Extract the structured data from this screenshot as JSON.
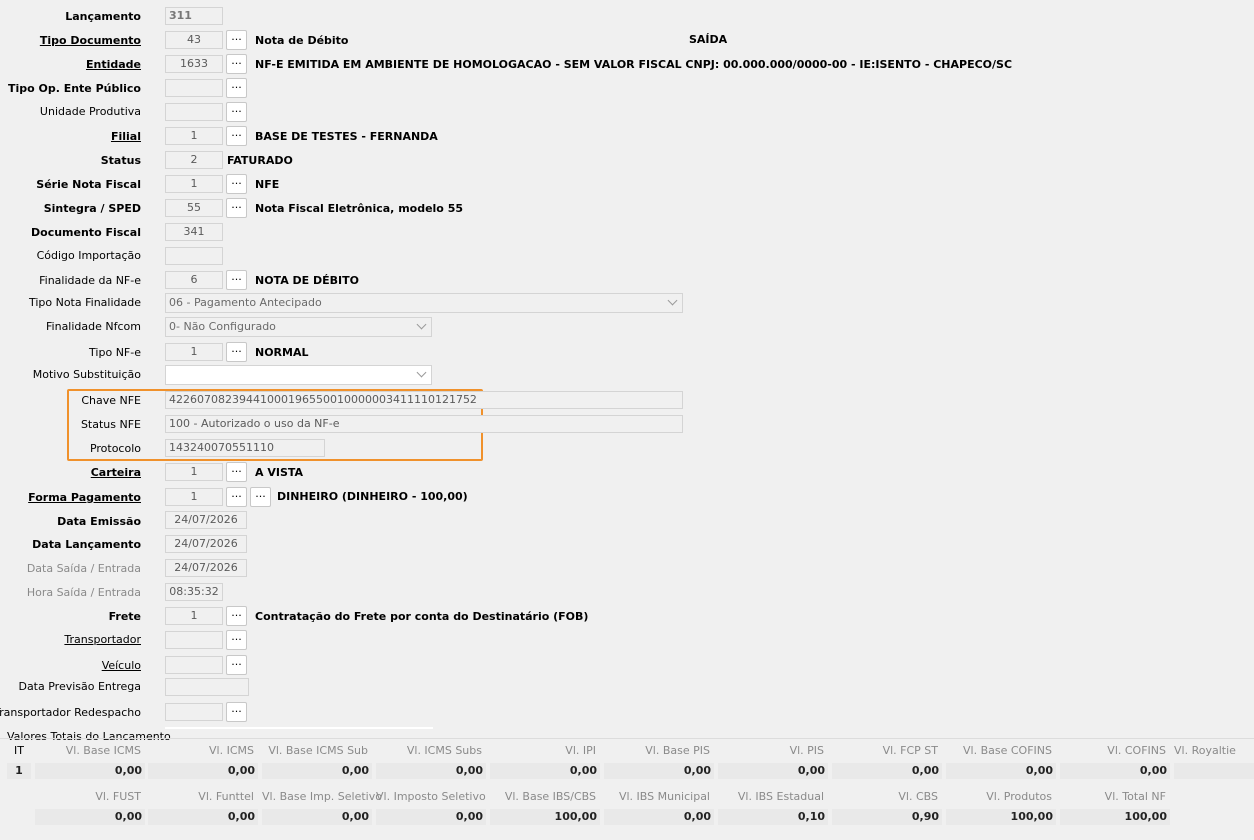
{
  "form": {
    "lancamento": {
      "label": "Lançamento",
      "value": "311"
    },
    "tipo_documento": {
      "label": "Tipo Documento",
      "code": "43",
      "desc": "Nota de Débito",
      "extra": "SAÍDA"
    },
    "entidade": {
      "label": "Entidade",
      "code": "1633",
      "desc": "NF-E EMITIDA EM AMBIENTE DE HOMOLOGACAO - SEM VALOR FISCAL CNPJ: 00.000.000/0000-00 - IE:ISENTO - CHAPECO/SC"
    },
    "tipo_op_ente": {
      "label": "Tipo Op. Ente Público",
      "code": ""
    },
    "unidade_produtiva": {
      "label": "Unidade Produtiva",
      "code": ""
    },
    "filial": {
      "label": "Filial",
      "code": "1",
      "desc": "BASE DE TESTES - FERNANDA"
    },
    "status": {
      "label": "Status",
      "code": "2",
      "desc": "FATURADO"
    },
    "serie": {
      "label": "Série Nota Fiscal",
      "code": "1",
      "desc": "NFE"
    },
    "sintegra": {
      "label": "Sintegra / SPED",
      "code": "55",
      "desc": "Nota Fiscal Eletrônica, modelo 55"
    },
    "documento_fiscal": {
      "label": "Documento Fiscal",
      "value": "341"
    },
    "codigo_importacao": {
      "label": "Código Importação",
      "value": ""
    },
    "finalidade_nfe": {
      "label": "Finalidade da NF-e",
      "code": "6",
      "desc": "NOTA DE DÉBITO"
    },
    "tipo_nota_finalidade": {
      "label": "Tipo Nota Finalidade",
      "value": "06 - Pagamento Antecipado"
    },
    "finalidade_nfcom": {
      "label": "Finalidade Nfcom",
      "value": "0- Não Configurado"
    },
    "tipo_nfe": {
      "label": "Tipo NF-e",
      "code": "1",
      "desc": "NORMAL"
    },
    "motivo_substituicao": {
      "label": "Motivo Substituição",
      "value": ""
    },
    "chave_nfe": {
      "label": "Chave NFE",
      "value": "42260708239441000196550010000003411110121752"
    },
    "status_nfe": {
      "label": "Status NFE",
      "value": "100 - Autorizado o uso da NF-e"
    },
    "protocolo": {
      "label": "Protocolo",
      "value": "143240070551110"
    },
    "carteira": {
      "label": "Carteira",
      "code": "1",
      "desc": "A VISTA"
    },
    "forma_pagamento": {
      "label": "Forma Pagamento",
      "code": "1",
      "desc": "DINHEIRO (DINHEIRO - 100,00)"
    },
    "data_emissao": {
      "label": "Data Emissão",
      "value": "24/07/2026"
    },
    "data_lancamento": {
      "label": "Data Lançamento",
      "value": "24/07/2026"
    },
    "data_saida": {
      "label": "Data Saída / Entrada",
      "value": "24/07/2026"
    },
    "hora_saida": {
      "label": "Hora Saída / Entrada",
      "value": "08:35:32"
    },
    "frete": {
      "label": "Frete",
      "code": "1",
      "desc": "Contratação do Frete por conta do Destinatário (FOB)"
    },
    "transportador": {
      "label": "Transportador",
      "code": ""
    },
    "veiculo": {
      "label": "Veículo",
      "code": ""
    },
    "data_previsao": {
      "label": "Data Previsão Entrega",
      "value": ""
    },
    "transportador_redespacho": {
      "label": "Transportador Redespacho",
      "code": ""
    },
    "button_label": "..."
  },
  "totals": {
    "section_title": "Valores Totais do Lancamento",
    "it_header": "IT",
    "it_value": "1",
    "row1": [
      {
        "h": "Vl. Base ICMS",
        "v": "0,00"
      },
      {
        "h": "Vl. ICMS",
        "v": "0,00"
      },
      {
        "h": "Vl. Base ICMS Sub",
        "v": "0,00"
      },
      {
        "h": "Vl. ICMS Subs",
        "v": "0,00"
      },
      {
        "h": "Vl. IPI",
        "v": "0,00"
      },
      {
        "h": "Vl. Base PIS",
        "v": "0,00"
      },
      {
        "h": "Vl. PIS",
        "v": "0,00"
      },
      {
        "h": "Vl. FCP ST",
        "v": "0,00"
      },
      {
        "h": "Vl. Base COFINS",
        "v": "0,00"
      },
      {
        "h": "Vl. COFINS",
        "v": "0,00"
      },
      {
        "h": "Vl. Royaltie",
        "v": ""
      }
    ],
    "row2": [
      {
        "h": "Vl. FUST",
        "v": "0,00"
      },
      {
        "h": "Vl. Funttel",
        "v": "0,00"
      },
      {
        "h": "Vl. Base Imp. Seletivo",
        "v": "0,00"
      },
      {
        "h": "Vl. Imposto Seletivo",
        "v": "0,00"
      },
      {
        "h": "Vl. Base IBS/CBS",
        "v": "100,00"
      },
      {
        "h": "Vl. IBS Municipal",
        "v": "0,00"
      },
      {
        "h": "Vl. IBS Estadual",
        "v": "0,10"
      },
      {
        "h": "Vl. CBS",
        "v": "0,90"
      },
      {
        "h": "Vl. Produtos",
        "v": "100,00"
      },
      {
        "h": "Vl. Total NF",
        "v": "100,00"
      }
    ]
  }
}
